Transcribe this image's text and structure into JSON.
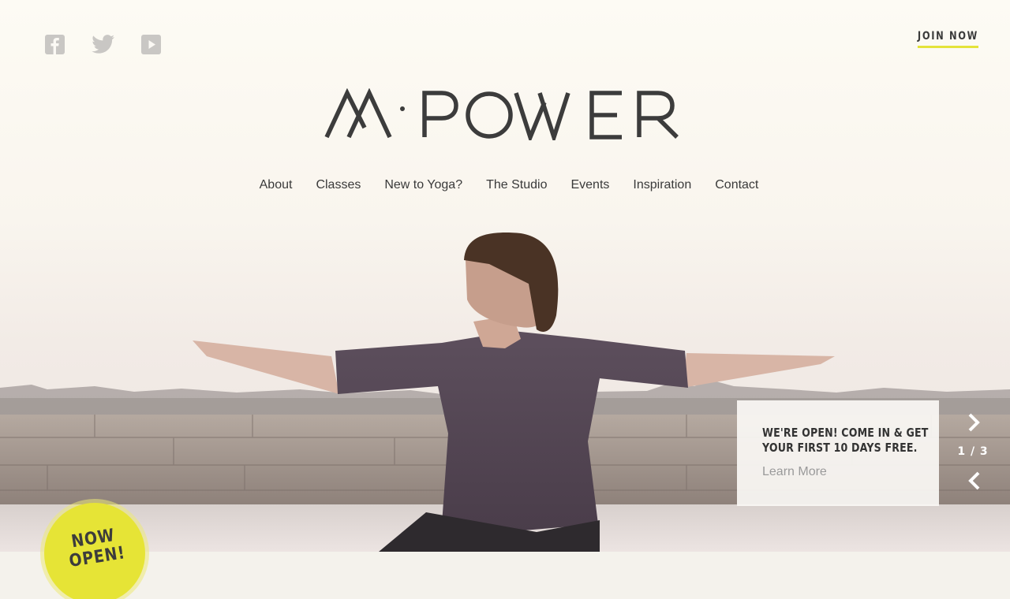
{
  "brand": {
    "name": "M·POWER"
  },
  "header": {
    "social": [
      "facebook-icon",
      "twitter-icon",
      "youtube-icon"
    ],
    "join_label": "JOIN NOW"
  },
  "nav": {
    "items": [
      "About",
      "Classes",
      "New to Yoga?",
      "The Studio",
      "Events",
      "Inspiration",
      "Contact"
    ]
  },
  "promo": {
    "title_line1": "WE'RE OPEN! COME IN & GET",
    "title_line2": "YOUR FIRST 10 DAYS FREE.",
    "link": "Learn More"
  },
  "slider": {
    "counter": "1 / 3",
    "current": 1,
    "total": 3
  },
  "badge": {
    "line1": "NOW",
    "line2": "OPEN!"
  },
  "colors": {
    "accent": "#e6e436",
    "text": "#3a3a3a",
    "muted": "#9a9a9a",
    "background": "#f4f2ec"
  }
}
